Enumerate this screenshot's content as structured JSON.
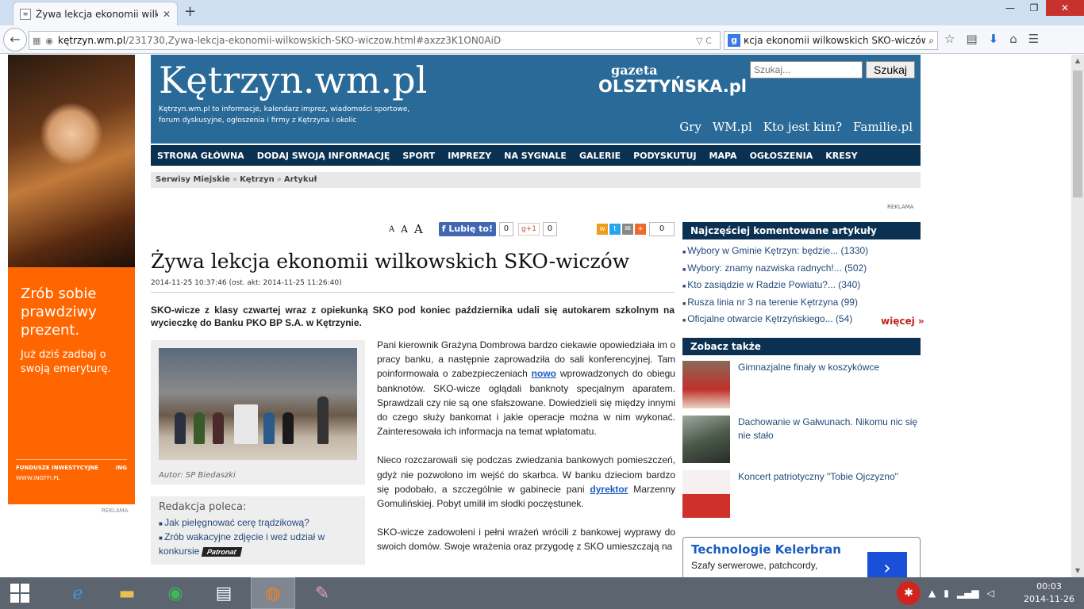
{
  "browser": {
    "tab_title": "Żywa lekcja ekonomii wilkowskich SKO-wiczów",
    "tab_close": "✕",
    "new_tab": "+",
    "url_domain": "kętrzyn.wm.pl",
    "url_path": "/231730,Zywa-lekcja-ekonomii-wilkowskich-SKO-wiczow.html#axzz3K1ON0AiD",
    "search_text": "ҝcja ekonomii wilkowskich SKO-wiczów",
    "window_controls": [
      "—",
      "❐",
      "✕"
    ]
  },
  "ad": {
    "headline": "Zrób sobie prawdziwy prezent.",
    "sub": "Już dziś zadbaj o swoją emeryturę.",
    "foot_left": "FUNDUSZE INWESTYCYJNE",
    "foot_right": "ING",
    "url": "WWW.INGTFI.PL",
    "label": "REKLAMA"
  },
  "header": {
    "logo": "Kętrzyn.wm.pl",
    "tagline": "Kętrzyn.wm.pl to informacje, kalendarz imprez, wiadomości sportowe, forum dyskusyjne, ogłoszenia i firmy z Kętrzyna i okolic",
    "gazeta_top": "gazeta",
    "gazeta_bottom": "OLSZTYŃSKA.pl",
    "search_placeholder": "Szukaj...",
    "search_button": "Szukaj",
    "links": [
      "Gry",
      "WM.pl",
      "Kto jest kim?",
      "Familie.pl"
    ]
  },
  "nav": [
    "STRONA GŁÓWNA",
    "DODAJ SWOJĄ INFORMACJĘ",
    "SPORT",
    "IMPREZY",
    "NA SYGNALE",
    "GALERIE",
    "PODYSKUTUJ",
    "MAPA",
    "OGŁOSZENIA",
    "KRESY"
  ],
  "breadcrumb": [
    "Serwisy Miejskie",
    "Kętrzyn",
    "Artykuł"
  ],
  "breadcrumb_sep": "»",
  "reklama": "REKLAMA",
  "social": {
    "font_sizes": [
      "A",
      "A",
      "A"
    ],
    "fb_label": "Lubię to!",
    "fb_count": "0",
    "gplus_label": "g+1",
    "gplus_count": "0",
    "share_count": "0"
  },
  "article": {
    "title": "Żywa lekcja ekonomii wilkowskich SKO-wiczów",
    "date": "2014-11-25 10:37:46 (ost. akt: 2014-11-25 11:26:40)",
    "lead": "SKO-wicze z klasy czwartej wraz z opiekunką SKO pod koniec października udali się autokarem szkolnym na wycieczkę do Banku PKO BP S.A. w Kętrzynie.",
    "caption": "Autor: SP Biedaszki",
    "p1a": "Pani kierownik Grażyna Dombrowa bardzo ciekawie opowiedziała im o pracy banku, a następnie zaprowadziła do sali konferencyjnej. Tam poinformowała o zabezpieczeniach ",
    "p1_link": "nowo",
    "p1b": " wprowadzonych do obiegu banknotów. SKO-wicze oglądali banknoty specjalnym aparatem. Sprawdzali czy nie są one sfałszowane. Dowiedzieli się między innymi do czego służy bankomat i jakie operacje można w nim wykonać. Zainteresowała ich informacja na temat wpłatomatu.",
    "p2a": "Nieco rozczarowali się podczas zwiedzania bankowych pomieszczeń, gdyż nie pozwolono im wejść do skarbca. W banku dzieciom bardzo się podobało, a szczególnie w gabinecie pani ",
    "p2_link": "dyrektor",
    "p2b": " Marzenny Gomulińskiej. Pobyt umilił im słodki poczęstunek.",
    "p3": "SKO-wicze zadowoleni i pełni wrażeń wrócili z bankowej wyprawy do swoich domów. Swoje wrażenia oraz przygodę z SKO umieszczają na"
  },
  "poleca": {
    "title": "Redakcja poleca:",
    "items": [
      "Jak pielęgnować cerę trądzikową?",
      "Zrób wakacyjne zdjęcie i weź udział w konkursie"
    ],
    "badge": "Patronat"
  },
  "most_commented": {
    "title": "Najczęściej komentowane artykuły",
    "items": [
      "Wybory w Gminie Kętrzyn: będzie... (1330)",
      "Wybory: znamy nazwiska radnych!... (502)",
      "Kto zasiądzie w Radzie Powiatu?... (340)",
      "Rusza linia nr 3 na terenie Kętrzyna (99)",
      "Oficjalne otwarcie Kętrzyńskiego... (54)"
    ],
    "more": "więcej »"
  },
  "see_also": {
    "title": "Zobacz także",
    "items": [
      "Gimnazjalne finały w koszykówce",
      "Dachowanie w Gałwunach. Nikomu nic się nie stało",
      "Koncert patriotyczny \"Tobie Ojczyzno\""
    ]
  },
  "promo": {
    "title": "Technologie Kelerbran",
    "desc": "Szafy serwerowe, patchcordy,"
  },
  "taskbar": {
    "time": "00:03",
    "date": "2014-11-26"
  }
}
